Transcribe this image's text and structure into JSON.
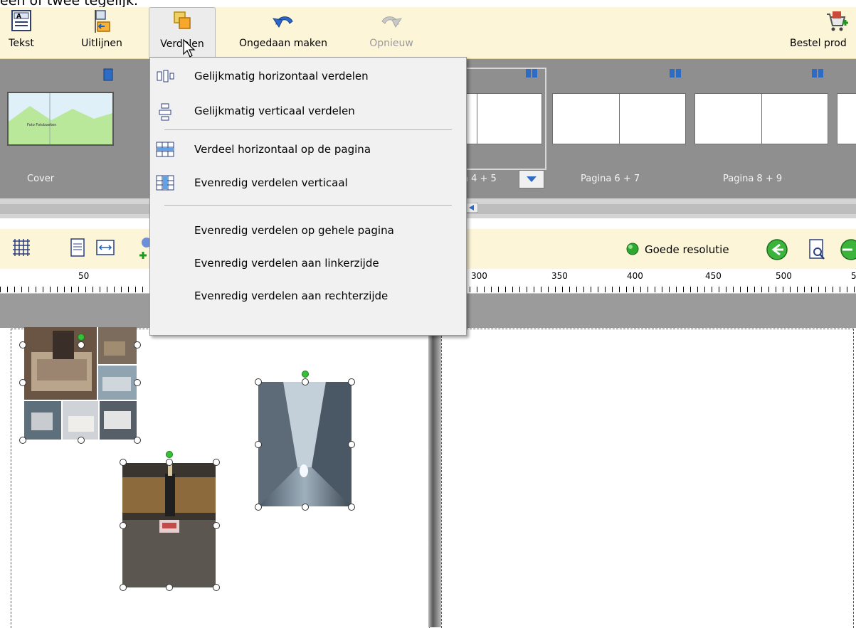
{
  "caption": "een of twee tegelijk.",
  "toolbar": {
    "text_label": "Tekst",
    "align_label": "Uitlijnen",
    "distribute_label": "Verdelen",
    "undo_label": "Ongedaan maken",
    "redo_label": "Opnieuw",
    "order_label": "Bestel prod"
  },
  "strip": {
    "items": [
      {
        "label": "Cover"
      },
      {
        "label": "a 4 + 5"
      },
      {
        "label": "Pagina 6 + 7"
      },
      {
        "label": "Pagina 8 + 9"
      }
    ],
    "cover_text": "Foto Fotoboeken"
  },
  "toolbar2": {
    "resolution_label": "Goede resolutie",
    "resolution_color": "#2fa82f"
  },
  "ruler": {
    "ticks": [
      "50",
      "300",
      "350",
      "400",
      "450",
      "500",
      "5"
    ]
  },
  "menu": {
    "items": [
      {
        "label": "Gelijkmatig horizontaal verdelen",
        "icon": "distribute-horizontal-icon"
      },
      {
        "label": "Gelijkmatig verticaal verdelen",
        "icon": "distribute-vertical-icon"
      },
      {
        "label": "Verdeel horizontaal op de pagina",
        "icon": "grid-horizontal-icon"
      },
      {
        "label": "Evenredig verdelen verticaal",
        "icon": "grid-vertical-icon"
      },
      {
        "label": "Evenredig verdelen op gehele pagina"
      },
      {
        "label": "Evenredig verdelen aan linkerzijde"
      },
      {
        "label": "Evenredig verdelen aan rechterzijde"
      }
    ]
  },
  "colors": {
    "toolbar_bg": "#fdf5d8",
    "strip_bg": "#8f8f8f",
    "menu_bg": "#f1f1f1"
  }
}
